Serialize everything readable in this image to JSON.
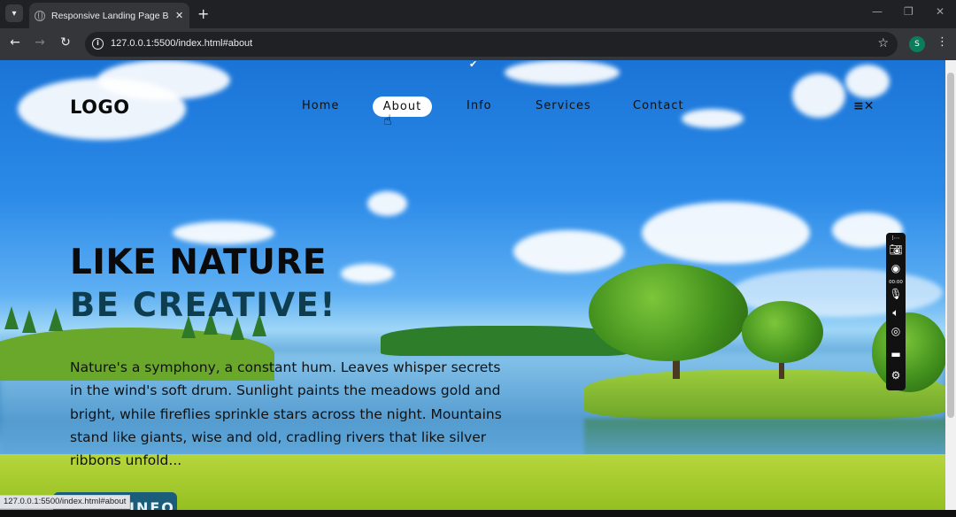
{
  "browser": {
    "tab_title": "Responsive Landing Page BySm",
    "tab_close": "✕",
    "new_tab": "+",
    "url": "127.0.0.1:5500/index.html#about",
    "status_url": "127.0.0.1:5500/index.html#about",
    "profile_initial": "S",
    "icons": [
      "tab-search-icon",
      "back-arrow-icon",
      "forward-arrow-icon",
      "reload-icon",
      "site-info-icon",
      "bookmark-star-icon",
      "menu-kebab-icon",
      "minimize-icon",
      "restore-icon",
      "close-window-icon"
    ]
  },
  "site": {
    "logo": "LOGO",
    "nav": [
      {
        "label": "Home",
        "active": false
      },
      {
        "label": "About",
        "active": true
      },
      {
        "label": "Info",
        "active": false
      },
      {
        "label": "Services",
        "active": false
      },
      {
        "label": "Contact",
        "active": false
      }
    ],
    "menu_toggle": "≡✕",
    "hero": {
      "title_line1": "LIKE NATURE",
      "title_line2": "BE CREATIVE!",
      "paragraph": "Nature's a symphony, a constant hum. Leaves whisper secrets in the wind's soft drum. Sunlight paints the meadows gold and bright, while fireflies sprinkle stars across the night. Mountains stand like giants, wise and old, cradling rivers that like silver ribbons unfold...",
      "button_label": "INFO"
    }
  },
  "recorder": {
    "time": "00:00",
    "icons": [
      "camera-icon",
      "record-icon",
      "microphone-icon",
      "speaker-icon",
      "webcam-icon",
      "window-icon",
      "settings-icon"
    ]
  },
  "colors": {
    "accent_dark": "#0e3d50",
    "button": "#1a5c7a",
    "chrome_dark": "#202124",
    "chrome_mid": "#35363a"
  }
}
